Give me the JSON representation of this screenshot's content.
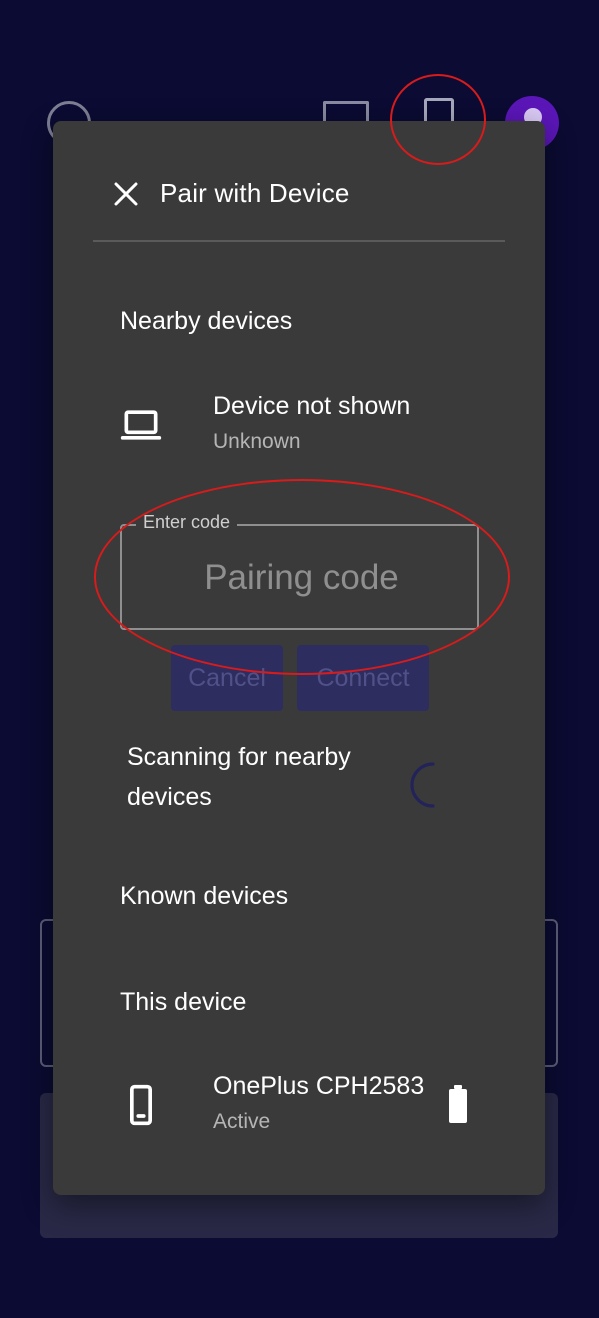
{
  "dialog": {
    "title": "Pair with Device",
    "close_icon": "close-icon"
  },
  "nearby": {
    "heading": "Nearby devices",
    "device": {
      "name": "Device not shown",
      "status": "Unknown",
      "icon": "laptop-icon"
    }
  },
  "pairing": {
    "label": "Enter code",
    "placeholder": "Pairing code",
    "value": "",
    "cancel_label": "Cancel",
    "connect_label": "Connect"
  },
  "scanning": {
    "text": "Scanning for nearby devices",
    "spinner_icon": "spinner-icon"
  },
  "known": {
    "heading": "Known devices"
  },
  "this_device": {
    "heading": "This device",
    "name": "OnePlus CPH2583",
    "status": "Active",
    "icon": "phone-icon",
    "battery_icon": "battery-icon"
  },
  "colors": {
    "background": "#0b0b33",
    "dialog": "#3a3a3a",
    "accent": "#2d2d60",
    "annotation": "#d81b1b"
  }
}
